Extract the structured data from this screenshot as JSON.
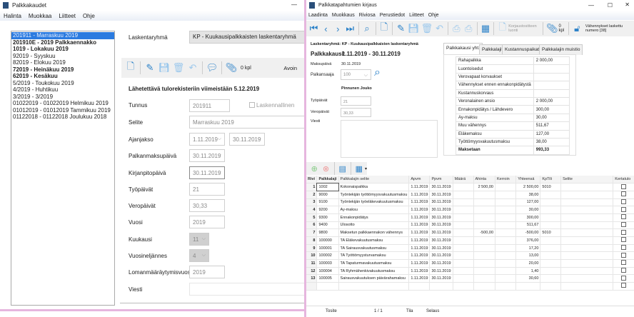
{
  "left": {
    "title": "Palkkakaudet",
    "menu": [
      "Halinta",
      "Muokkaa",
      "Liitteet",
      "Ohje"
    ],
    "periods": [
      {
        "label": "201911 - Marraskuu 2019",
        "bold": false,
        "selected": true
      },
      {
        "label": "201910E - 2019 Palkkaennakko",
        "bold": true
      },
      {
        "label": "1019 - Lokakuu 2019",
        "bold": true
      },
      {
        "label": "92019 - Syyskuu",
        "bold": false
      },
      {
        "label": "82019 - Elokuu 2019",
        "bold": false
      },
      {
        "label": "72019 - Heinäkuu 2019",
        "bold": true
      },
      {
        "label": "62019 - Kesäkuu",
        "bold": true
      },
      {
        "label": "5/2019 - Toukokuu 2019",
        "bold": false
      },
      {
        "label": "4/2019 - Huhtikuu",
        "bold": false
      },
      {
        "label": "3/2019 - 3/2019",
        "bold": false
      },
      {
        "label": "01022019 - 01022019 Helmikuu 2019",
        "bold": false
      },
      {
        "label": "01012019 - 01012019 Tammikuu 2019",
        "bold": false
      },
      {
        "label": "01122018 - 01122018 Joulukuu 2018",
        "bold": false
      }
    ],
    "group_label": "Laskentaryhmä",
    "group_value": "KP - Kuukausipalkkaisten laskentaryhmä",
    "attachments": "0 kpl",
    "status": "Avoin",
    "notice": "Lähetettävä tulorekisteriin viimeistään 5.12.2019",
    "fields": {
      "tunnus_label": "Tunnus",
      "tunnus": "201911",
      "calc_label": "Laskennallinen",
      "selite_label": "Selite",
      "selite": "Marraskuu 2019",
      "ajanjakso_label": "Ajanjakso",
      "start": "1.11.2019",
      "end": "30.11.2019",
      "maksupaiva_label": "Palkanmaksupäivä",
      "maksupaiva": "30.11.2019",
      "kirjanpito_label": "Kirjanpitopäivä",
      "kirjanpito": "30.11.2019",
      "tyopaivat_label": "Työpäivät",
      "tyopaivat": "21",
      "veropaivat_label": "Veropäivät",
      "veropaivat": "30,33",
      "vuosi_label": "Vuosi",
      "vuosi": "2019",
      "kuukausi_label": "Kuukausi",
      "kuukausi": "11",
      "neljannes_label": "Vuosineljännes",
      "neljannes": "4",
      "loma_label": "Lomanmääräytymisvuosi",
      "loma": "2019",
      "viesti_label": "Viesti",
      "viesti": ""
    }
  },
  "right": {
    "title": "Palkkatapahtumien kirjaus",
    "menu": [
      "Laadinta",
      "Muokkaus",
      "Riviosa",
      "Perustiedot",
      "Liitteet",
      "Ohje"
    ],
    "correction_label": "Korjaustositteen luonti",
    "attachments": "0 kpl",
    "deductions": "Vähennykset laskettu numero [38]",
    "group_line": "Laskentaryhmä:  KP - Kuukausipalkkaisten laskentaryhmä",
    "period_label": "Palkkakausi:",
    "period": "1.11.2019 - 30.11.2019",
    "maksupaiva_label": "Maksupäivä",
    "maksupaiva": "30.11.2019",
    "palkansaaja_label": "Palkansaaja",
    "palkansaaja": "100",
    "name": "Pinnunen Jouko",
    "tyopaivat_label": "Työpäivät",
    "tyopaivat": "21",
    "veropaivat_label": "Veropäivät",
    "veropaivat": "30,33",
    "viesti_label": "Viesti",
    "tabs": [
      "Palkkakausi yht.",
      "Palkkalajit",
      "Kustannuspaikat",
      "Palkkalajin muistio"
    ],
    "summary": [
      [
        "Rahapalkka",
        "2 000,00"
      ],
      [
        "Luontoisedut",
        ""
      ],
      [
        "Verovapaat korvaukset",
        ""
      ],
      [
        "Vähennykset ennen ennakonpidätystä",
        ""
      ],
      [
        "Kustannuskorvaus",
        ""
      ],
      [
        "Veronalainen ansio",
        "2 000,00"
      ],
      [
        "Ennakonpidätys / Lähdevero",
        "300,00"
      ],
      [
        "Ay-maksu",
        "30,00"
      ],
      [
        "Muu vähennys",
        "511,67"
      ],
      [
        "Eläkemaksu",
        "127,00"
      ],
      [
        "Työttömyysvakuutusmaksu",
        "38,00"
      ],
      [
        "Maksetaan",
        "993,33"
      ]
    ],
    "columns": [
      "Rivi",
      "Palkkalaji",
      "Palkkalajin selite",
      "Apvm",
      "Ppvm",
      "Määrä",
      "Ahinta",
      "Kerroin",
      "Yhteensä",
      "KpTili",
      "Selite",
      "Kertatulo"
    ],
    "rows": [
      [
        "1",
        "1002",
        "Kokonaispalkka",
        "1.11.2019",
        "30.11.2019",
        "",
        "2 500,00",
        "",
        "2 500,00",
        "5010",
        ""
      ],
      [
        "2",
        "9000",
        "Työntekijän työttömyysvakuutusmaksu",
        "1.11.2019",
        "30.11.2019",
        "",
        "",
        "",
        "38,00",
        "",
        ""
      ],
      [
        "3",
        "9100",
        "Työntekijän työeläkevakuutusmaksu",
        "1.11.2019",
        "30.11.2019",
        "",
        "",
        "",
        "127,00",
        "",
        ""
      ],
      [
        "4",
        "9200",
        "Ay-maksu",
        "1.11.2019",
        "30.11.2019",
        "",
        "",
        "",
        "30,00",
        "",
        ""
      ],
      [
        "5",
        "9300",
        "Ennakonpidätys",
        "1.11.2019",
        "30.11.2019",
        "",
        "",
        "",
        "300,00",
        "",
        ""
      ],
      [
        "6",
        "9400",
        "Ulosotto",
        "1.11.2019",
        "30.11.2019",
        "",
        "",
        "",
        "511,67",
        "",
        ""
      ],
      [
        "7",
        "9800",
        "Maksetun palkkaennakon vähennys",
        "1.11.2019",
        "30.11.2019",
        "",
        "-500,00",
        "",
        "-500,00",
        "5010",
        ""
      ],
      [
        "8",
        "100000",
        "TA Eläkevakuutusmaksu",
        "1.11.2019",
        "30.11.2019",
        "",
        "",
        "",
        "376,00",
        "",
        ""
      ],
      [
        "9",
        "100001",
        "TA Sairausvakuutusmaksu",
        "1.11.2019",
        "30.11.2019",
        "",
        "",
        "",
        "17,20",
        "",
        ""
      ],
      [
        "10",
        "100002",
        "TA Työttömyysturvamaksu",
        "1.11.2019",
        "30.11.2019",
        "",
        "",
        "",
        "13,00",
        "",
        ""
      ],
      [
        "11",
        "100003",
        "TA Tapaturmavakuutusmaksu",
        "1.11.2019",
        "30.11.2019",
        "",
        "",
        "",
        "20,00",
        "",
        ""
      ],
      [
        "12",
        "100004",
        "TA Ryhmähenkivakuutusmaksu",
        "1.11.2019",
        "30.11.2019",
        "",
        "",
        "",
        "1,40",
        "",
        ""
      ],
      [
        "13",
        "100005",
        "Sairausvakuutuksen päivärahamaksu",
        "1.11.2019",
        "30.11.2019",
        "",
        "",
        "",
        "30,60",
        "",
        ""
      ]
    ],
    "status": {
      "label": "Tosite",
      "page": "1 / 1",
      "tila_label": "Tila",
      "selaus": "Selaus"
    }
  }
}
